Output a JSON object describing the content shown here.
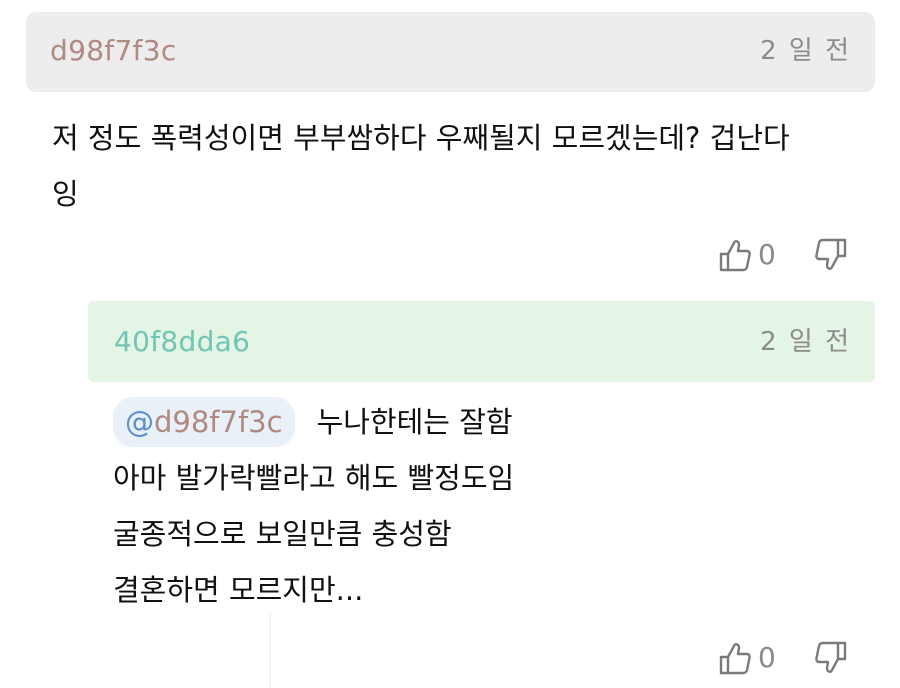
{
  "comments": [
    {
      "author": "d98f7f3c",
      "time": "2 일 전",
      "text_lines": [
        "저 정도 폭력성이면 부부쌈하다 우째될지 모르겠는데? 겁난다",
        "잉"
      ],
      "like_count": "0"
    }
  ],
  "reply": {
    "author": "40f8dda6",
    "time": "2 일 전",
    "mention_at": "@",
    "mention_name": "d98f7f3c",
    "text_lines": [
      "누나한테는 잘함",
      "아마 발가락빨라고 해도 빨정도임",
      "굴종적으로 보일만큼 충성함",
      "결혼하면 모르지만..."
    ],
    "like_count": "0"
  },
  "icons": {
    "like": "thumbs-up-icon",
    "dislike": "thumbs-down-icon"
  },
  "colors": {
    "author_1": "#b08a82",
    "author_2": "#71c5b4",
    "reply_header_bg": "#e4f5e5",
    "comment_header_bg": "#ededed",
    "mention_at": "#5a8fd0"
  }
}
